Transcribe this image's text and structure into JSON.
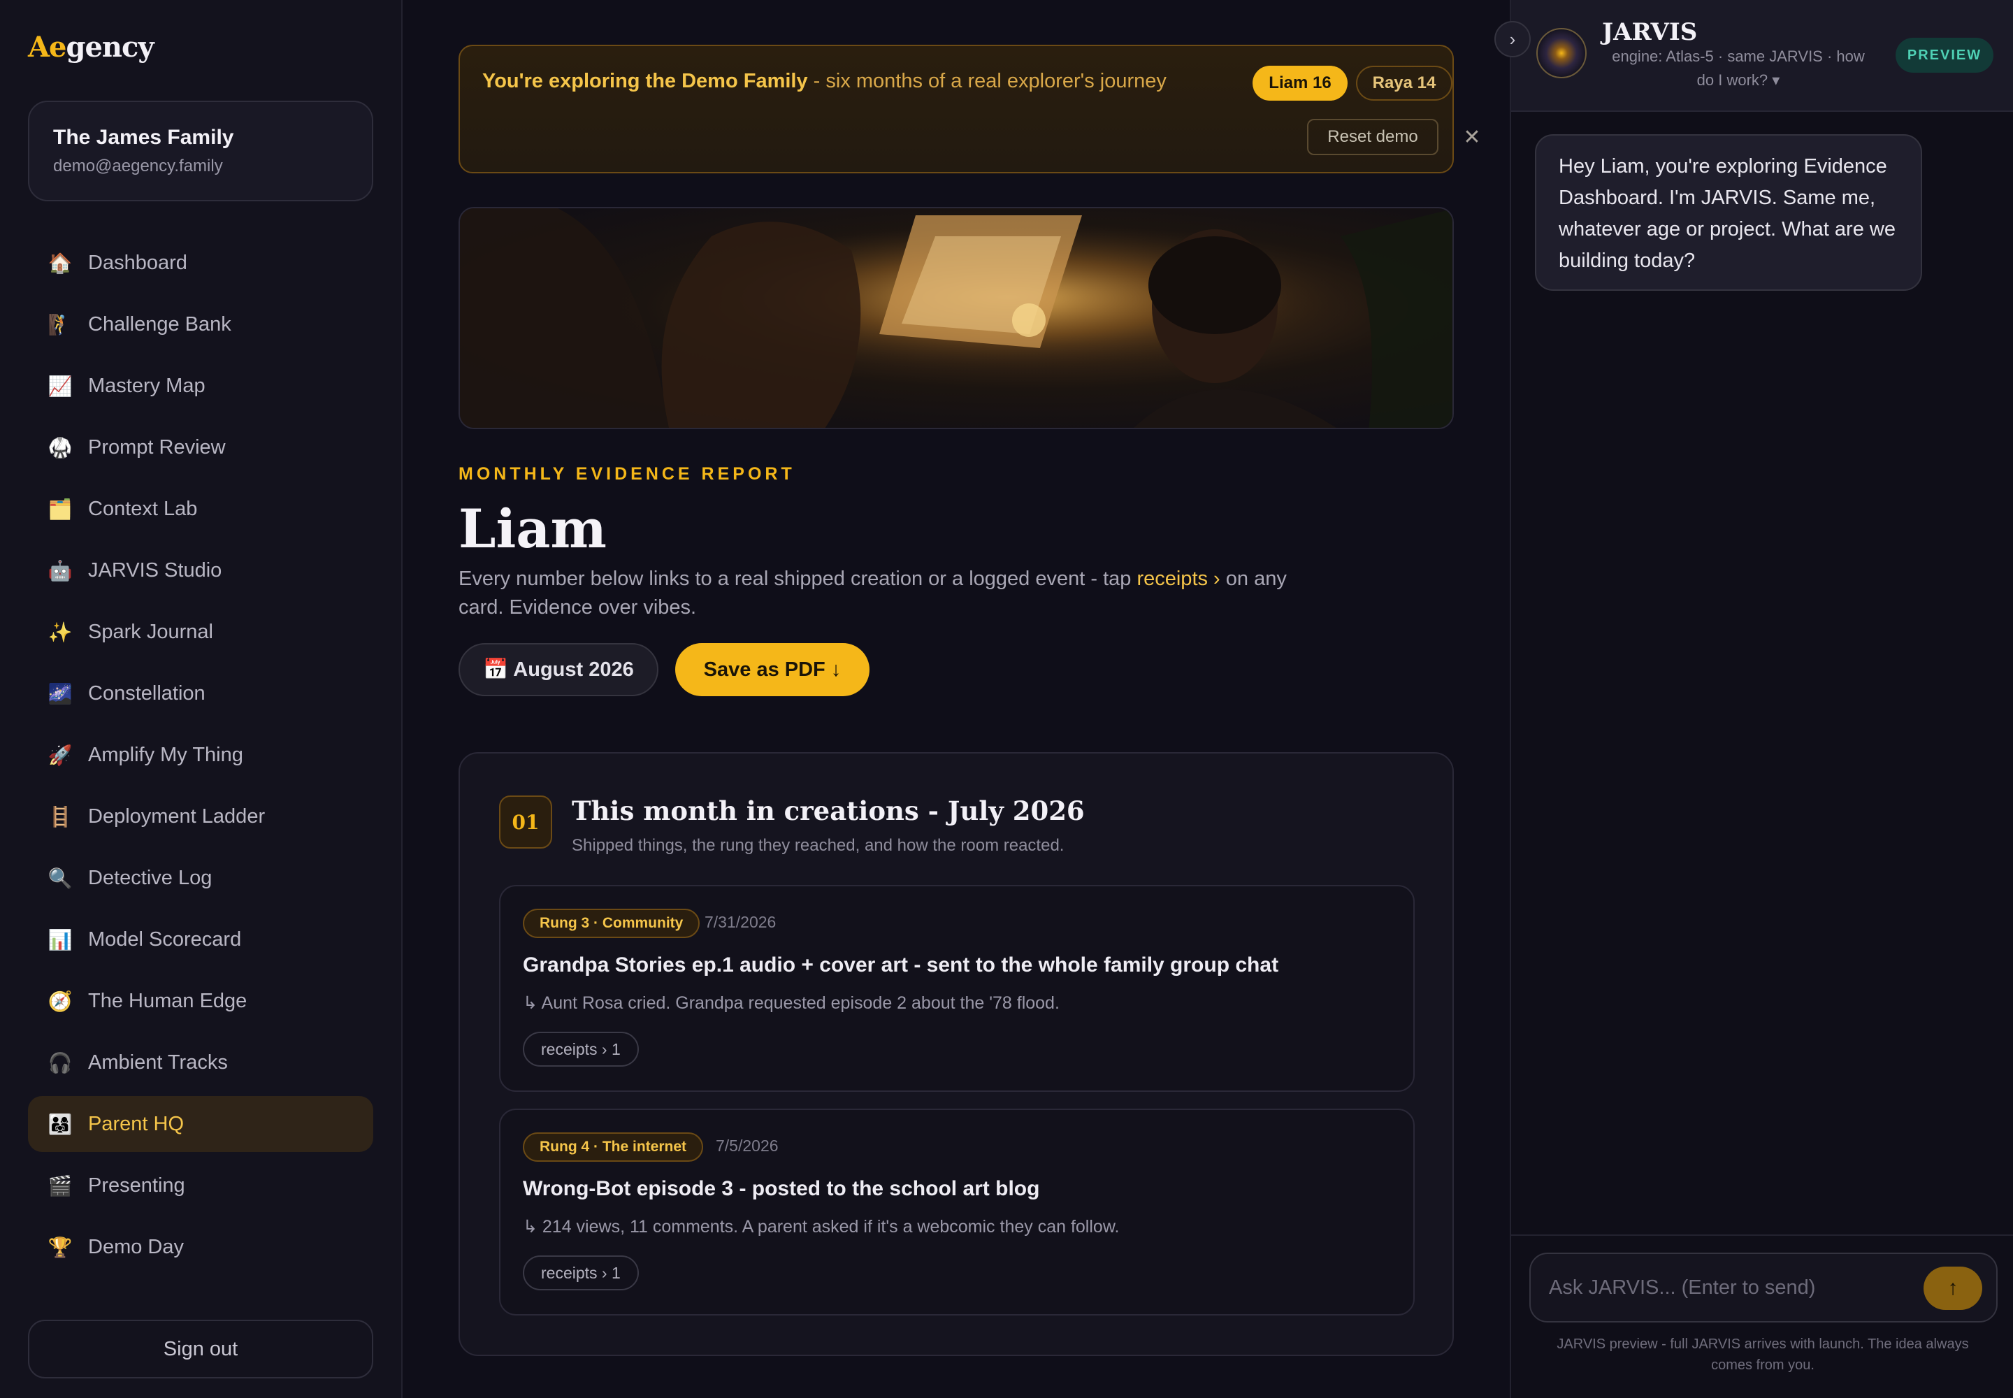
{
  "brand": {
    "logo_accent": "Ae",
    "logo_rest": "gency"
  },
  "family": {
    "name": "The James Family",
    "email": "demo@aegency.family"
  },
  "nav": [
    {
      "icon": "🏠",
      "icon_name": "home-icon",
      "label": "Dashboard"
    },
    {
      "icon": "🧗",
      "icon_name": "climber-icon",
      "label": "Challenge Bank"
    },
    {
      "icon": "📈",
      "icon_name": "chart-icon",
      "label": "Mastery Map"
    },
    {
      "icon": "🥋",
      "icon_name": "dojo-icon",
      "label": "Prompt Review"
    },
    {
      "icon": "🗂️",
      "icon_name": "folder-icon",
      "label": "Context Lab"
    },
    {
      "icon": "🤖",
      "icon_name": "robot-icon",
      "label": "JARVIS Studio"
    },
    {
      "icon": "✨",
      "icon_name": "sparkles-icon",
      "label": "Spark Journal"
    },
    {
      "icon": "🌌",
      "icon_name": "galaxy-icon",
      "label": "Constellation"
    },
    {
      "icon": "🚀",
      "icon_name": "rocket-icon",
      "label": "Amplify My Thing"
    },
    {
      "icon": "🪜",
      "icon_name": "ladder-icon",
      "label": "Deployment Ladder"
    },
    {
      "icon": "🔍",
      "icon_name": "magnifier-icon",
      "label": "Detective Log"
    },
    {
      "icon": "📊",
      "icon_name": "bar-chart-icon",
      "label": "Model Scorecard"
    },
    {
      "icon": "🧭",
      "icon_name": "compass-icon",
      "label": "The Human Edge"
    },
    {
      "icon": "🎧",
      "icon_name": "headphones-icon",
      "label": "Ambient Tracks"
    },
    {
      "icon": "👨‍👩‍👧",
      "icon_name": "family-icon",
      "label": "Parent HQ",
      "active": true
    },
    {
      "icon": "🎬",
      "icon_name": "clapper-icon",
      "label": "Presenting"
    },
    {
      "icon": "🏆",
      "icon_name": "trophy-icon",
      "label": "Demo Day"
    }
  ],
  "signout_label": "Sign out",
  "banner": {
    "bold": "You're exploring the Demo Family",
    "rest": " - six months of a real explorer's journey",
    "kids": [
      "Liam 16",
      "Raya 14"
    ],
    "reset_label": "Reset demo",
    "close_glyph": "✕"
  },
  "report": {
    "eyebrow": "MONTHLY EVIDENCE REPORT",
    "title": "Liam",
    "subtitle_a": "Every number below links to a real shipped creation or a logged event - tap ",
    "subtitle_link": "receipts ›",
    "subtitle_b": " on any card. Evidence over vibes.",
    "month_button": "📅 August 2026",
    "pdf_button": "Save as PDF ↓"
  },
  "section": {
    "number": "01",
    "title": "This month in creations - July 2026",
    "subtitle": "Shipped things, the rung they reached, and how the room reacted.",
    "entries": [
      {
        "rung": "Rung 3 · Community",
        "date": "7/31/2026",
        "title": "Grandpa Stories ep.1 audio + cover art - sent to the whole family group chat",
        "note": "↳ Aunt Rosa cried. Grandpa requested episode 2 about the '78 flood.",
        "receipts": "receipts › 1"
      },
      {
        "rung": "Rung 4 · The internet",
        "date": "7/5/2026",
        "title": "Wrong-Bot episode 3 - posted to the school art blog",
        "note": "↳ 214 views, 11 comments. A parent asked if it's a webcomic they can follow.",
        "receipts": "receipts › 1"
      }
    ]
  },
  "jarvis": {
    "collapse_glyph": "›",
    "name": "JARVIS",
    "engine": "engine: Atlas-5 · same JARVIS · how do I work? ▾",
    "badge": "PREVIEW",
    "message": "Hey Liam, you're exploring Evidence Dashboard. I'm JARVIS. Same me, whatever age or project. What are we building today?",
    "input_placeholder": "Ask JARVIS... (Enter to send)",
    "send_glyph": "↑",
    "footer": "JARVIS preview - full JARVIS arrives with launch. The idea always comes from you."
  },
  "colors": {
    "accent": "#f5b719",
    "background": "#0f0e19",
    "preview_badge": "#4fd1b5"
  }
}
